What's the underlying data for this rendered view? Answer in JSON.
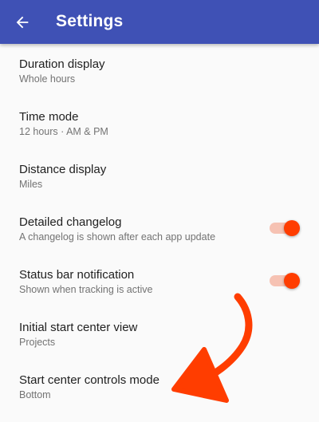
{
  "app_bar": {
    "title": "Settings",
    "back_icon": "arrow-back-icon",
    "color": "#3f51b5"
  },
  "settings": [
    {
      "title": "Duration display",
      "summary": "Whole hours"
    },
    {
      "title": "Time mode",
      "summary": "12 hours · AM & PM"
    },
    {
      "title": "Distance display",
      "summary": "Miles"
    },
    {
      "title": "Detailed changelog",
      "summary": "A changelog is shown after each app update",
      "switch": true
    },
    {
      "title": "Status bar notification",
      "summary": "Shown when tracking is active",
      "switch": true
    },
    {
      "title": "Initial start center view",
      "summary": "Projects"
    },
    {
      "title": "Start center controls mode",
      "summary": "Bottom"
    }
  ],
  "accent_color": "#ff3d00",
  "annotation": {
    "icon": "hand-drawn-arrow-icon",
    "color": "#ff3d00"
  }
}
